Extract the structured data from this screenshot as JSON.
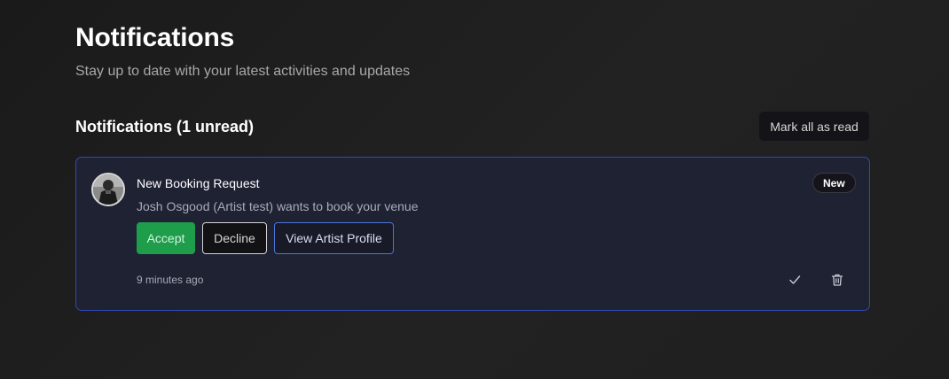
{
  "header": {
    "title": "Notifications",
    "subtitle": "Stay up to date with your latest activities and updates"
  },
  "section": {
    "title": "Notifications (1 unread)",
    "mark_all_label": "Mark all as read"
  },
  "notifications": [
    {
      "title": "New Booking Request",
      "message": "Josh Osgood (Artist test) wants to book your venue",
      "badge": "New",
      "time": "9 minutes ago",
      "actions": {
        "accept": "Accept",
        "decline": "Decline",
        "view_profile": "View Artist Profile"
      },
      "icons": [
        "check-icon",
        "trash-icon"
      ]
    }
  ],
  "colors": {
    "background": "#1e1e1e",
    "card_background": "#1f2233",
    "card_border": "#3149b5",
    "accept_green": "#1e9e4a",
    "profile_border": "#4b74d8"
  }
}
